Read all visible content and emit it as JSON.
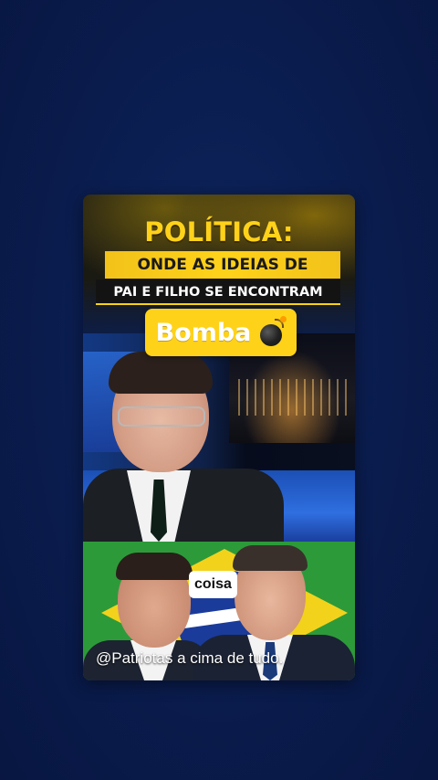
{
  "post": {
    "title": "POLÍTICA:",
    "subtitle_line1": "ONDE AS IDEIAS DE",
    "subtitle_line2": "PAI E FILHO SE ENCONTRAM",
    "badge": {
      "label": "Bomba",
      "icon": "bomb-icon"
    },
    "caption_word": "coisa",
    "watermark": "@Patriotas a cima de tudo."
  },
  "colors": {
    "background": "#0a1c4d",
    "accent_yellow": "#ffd21a",
    "flag_green": "#2d9a3a",
    "flag_blue": "#1a3b9a"
  }
}
